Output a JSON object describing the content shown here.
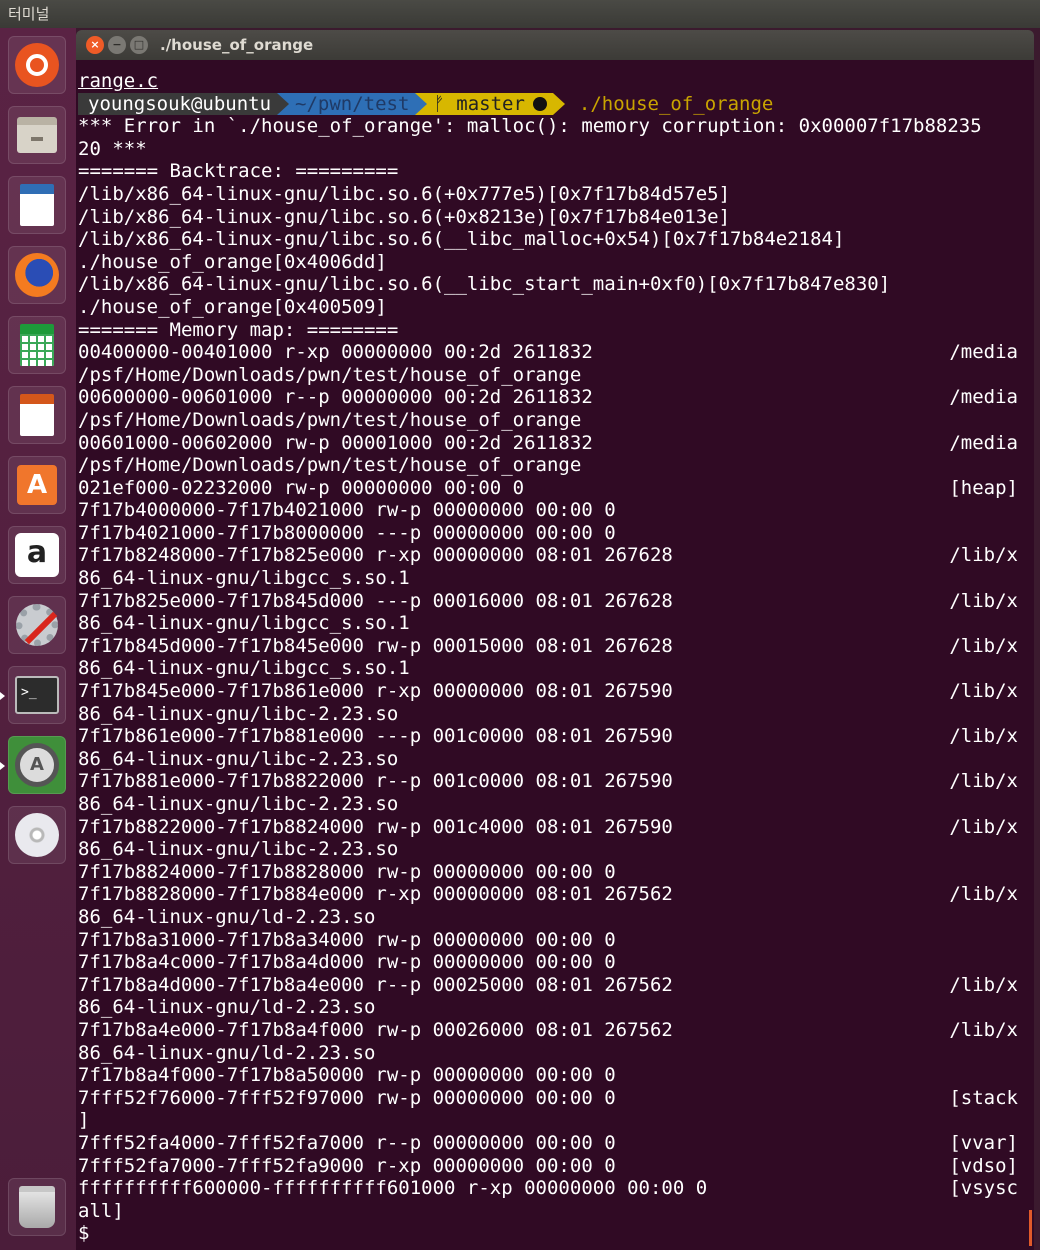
{
  "top_panel": {
    "app_title": "터미널"
  },
  "launcher": {
    "items": [
      {
        "id": "dash",
        "icon": "ubuntu-dash-icon"
      },
      {
        "id": "files",
        "icon": "files-icon"
      },
      {
        "id": "writer",
        "icon": "libreoffice-writer-icon"
      },
      {
        "id": "firefox",
        "icon": "firefox-icon"
      },
      {
        "id": "calc",
        "icon": "libreoffice-calc-icon"
      },
      {
        "id": "impress",
        "icon": "libreoffice-impress-icon"
      },
      {
        "id": "software",
        "icon": "software-center-icon",
        "glyph": "A"
      },
      {
        "id": "amazon",
        "icon": "amazon-icon",
        "glyph": "a"
      },
      {
        "id": "settings",
        "icon": "system-settings-icon"
      },
      {
        "id": "terminal",
        "icon": "terminal-icon",
        "glyph": ">_"
      },
      {
        "id": "updater",
        "icon": "software-updater-icon",
        "glyph": "A"
      },
      {
        "id": "disc",
        "icon": "dvd-icon"
      },
      {
        "id": "trash",
        "icon": "trash-icon"
      }
    ]
  },
  "window": {
    "title": "./house_of_orange",
    "buttons": {
      "close": "×",
      "minimize": "−",
      "maximize": "□"
    }
  },
  "terminal": {
    "first_line": "range.c",
    "prompt": {
      "user": "youngsouk@ubuntu",
      "path": "~/pwn/test",
      "git_branch": "ᚠ master",
      "command": "./house_of_orange"
    },
    "lines": [
      {
        "l": "*** Error in `./house_of_orange': malloc(): memory corruption: 0x00007f17b88235",
        "r": ""
      },
      {
        "l": "20 ***",
        "r": ""
      },
      {
        "l": "======= Backtrace: =========",
        "r": ""
      },
      {
        "l": "/lib/x86_64-linux-gnu/libc.so.6(+0x777e5)[0x7f17b84d57e5]",
        "r": ""
      },
      {
        "l": "/lib/x86_64-linux-gnu/libc.so.6(+0x8213e)[0x7f17b84e013e]",
        "r": ""
      },
      {
        "l": "/lib/x86_64-linux-gnu/libc.so.6(__libc_malloc+0x54)[0x7f17b84e2184]",
        "r": ""
      },
      {
        "l": "./house_of_orange[0x4006dd]",
        "r": ""
      },
      {
        "l": "/lib/x86_64-linux-gnu/libc.so.6(__libc_start_main+0xf0)[0x7f17b847e830]",
        "r": ""
      },
      {
        "l": "./house_of_orange[0x400509]",
        "r": ""
      },
      {
        "l": "======= Memory map: ========",
        "r": ""
      },
      {
        "l": "00400000-00401000 r-xp 00000000 00:2d 2611832",
        "r": "/media"
      },
      {
        "l": "/psf/Home/Downloads/pwn/test/house_of_orange",
        "r": ""
      },
      {
        "l": "00600000-00601000 r--p 00000000 00:2d 2611832",
        "r": "/media"
      },
      {
        "l": "/psf/Home/Downloads/pwn/test/house_of_orange",
        "r": ""
      },
      {
        "l": "00601000-00602000 rw-p 00001000 00:2d 2611832",
        "r": "/media"
      },
      {
        "l": "/psf/Home/Downloads/pwn/test/house_of_orange",
        "r": ""
      },
      {
        "l": "021ef000-02232000 rw-p 00000000 00:00 0",
        "r": "[heap]"
      },
      {
        "l": "7f17b4000000-7f17b4021000 rw-p 00000000 00:00 0",
        "r": ""
      },
      {
        "l": "7f17b4021000-7f17b8000000 ---p 00000000 00:00 0",
        "r": ""
      },
      {
        "l": "7f17b8248000-7f17b825e000 r-xp 00000000 08:01 267628",
        "r": "/lib/x"
      },
      {
        "l": "86_64-linux-gnu/libgcc_s.so.1",
        "r": ""
      },
      {
        "l": "7f17b825e000-7f17b845d000 ---p 00016000 08:01 267628",
        "r": "/lib/x"
      },
      {
        "l": "86_64-linux-gnu/libgcc_s.so.1",
        "r": ""
      },
      {
        "l": "7f17b845d000-7f17b845e000 rw-p 00015000 08:01 267628",
        "r": "/lib/x"
      },
      {
        "l": "86_64-linux-gnu/libgcc_s.so.1",
        "r": ""
      },
      {
        "l": "7f17b845e000-7f17b861e000 r-xp 00000000 08:01 267590",
        "r": "/lib/x"
      },
      {
        "l": "86_64-linux-gnu/libc-2.23.so",
        "r": ""
      },
      {
        "l": "7f17b861e000-7f17b881e000 ---p 001c0000 08:01 267590",
        "r": "/lib/x"
      },
      {
        "l": "86_64-linux-gnu/libc-2.23.so",
        "r": ""
      },
      {
        "l": "7f17b881e000-7f17b8822000 r--p 001c0000 08:01 267590",
        "r": "/lib/x"
      },
      {
        "l": "86_64-linux-gnu/libc-2.23.so",
        "r": ""
      },
      {
        "l": "7f17b8822000-7f17b8824000 rw-p 001c4000 08:01 267590",
        "r": "/lib/x"
      },
      {
        "l": "86_64-linux-gnu/libc-2.23.so",
        "r": ""
      },
      {
        "l": "7f17b8824000-7f17b8828000 rw-p 00000000 00:00 0",
        "r": ""
      },
      {
        "l": "7f17b8828000-7f17b884e000 r-xp 00000000 08:01 267562",
        "r": "/lib/x"
      },
      {
        "l": "86_64-linux-gnu/ld-2.23.so",
        "r": ""
      },
      {
        "l": "7f17b8a31000-7f17b8a34000 rw-p 00000000 00:00 0",
        "r": ""
      },
      {
        "l": "7f17b8a4c000-7f17b8a4d000 rw-p 00000000 00:00 0",
        "r": ""
      },
      {
        "l": "7f17b8a4d000-7f17b8a4e000 r--p 00025000 08:01 267562",
        "r": "/lib/x"
      },
      {
        "l": "86_64-linux-gnu/ld-2.23.so",
        "r": ""
      },
      {
        "l": "7f17b8a4e000-7f17b8a4f000 rw-p 00026000 08:01 267562",
        "r": "/lib/x"
      },
      {
        "l": "86_64-linux-gnu/ld-2.23.so",
        "r": ""
      },
      {
        "l": "7f17b8a4f000-7f17b8a50000 rw-p 00000000 00:00 0",
        "r": ""
      },
      {
        "l": "7fff52f76000-7fff52f97000 rw-p 00000000 00:00 0",
        "r": "[stack"
      },
      {
        "l": "]",
        "r": ""
      },
      {
        "l": "7fff52fa4000-7fff52fa7000 r--p 00000000 00:00 0",
        "r": "[vvar]"
      },
      {
        "l": "7fff52fa7000-7fff52fa9000 r-xp 00000000 00:00 0",
        "r": "[vdso]"
      },
      {
        "l": "ffffffffff600000-ffffffffff601000 r-xp 00000000 00:00 0",
        "r": "[vsysc"
      },
      {
        "l": "all]",
        "r": ""
      },
      {
        "l": "$",
        "r": ""
      }
    ]
  },
  "colors": {
    "terminal_bg": "#300a24",
    "launcher_bg": "#5a2344",
    "prompt_user_bg": "#3a3a3a",
    "prompt_path_bg": "#2e6fb6",
    "prompt_git_bg": "#d7b700",
    "command_fg": "#c9a400",
    "close_button": "#ef5b27"
  }
}
